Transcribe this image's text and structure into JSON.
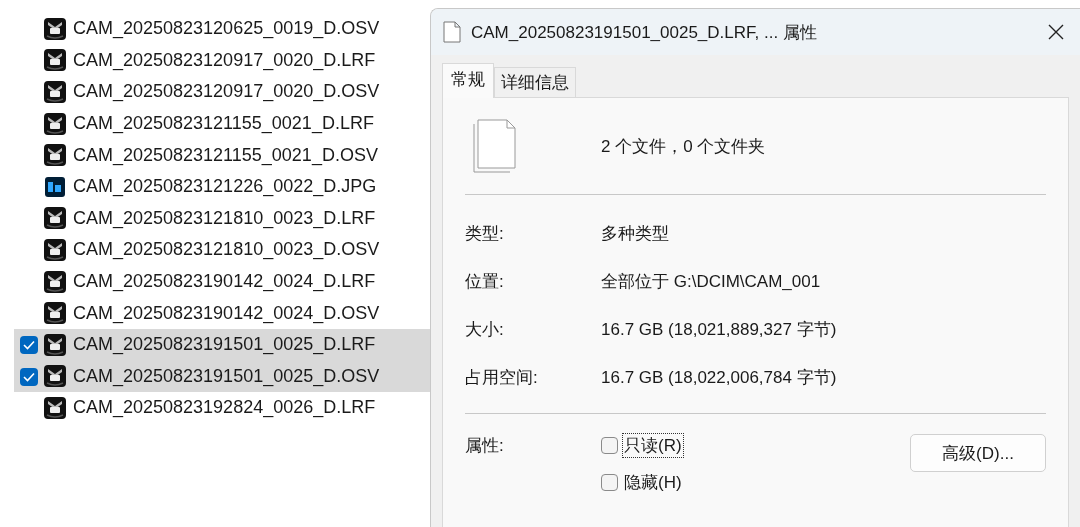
{
  "file_list": [
    {
      "name": "CAM_20250823120625_0019_D.OSV",
      "kind": "video",
      "selected": false
    },
    {
      "name": "CAM_20250823120917_0020_D.LRF",
      "kind": "video",
      "selected": false
    },
    {
      "name": "CAM_20250823120917_0020_D.OSV",
      "kind": "video",
      "selected": false
    },
    {
      "name": "CAM_20250823121155_0021_D.LRF",
      "kind": "video",
      "selected": false
    },
    {
      "name": "CAM_20250823121155_0021_D.OSV",
      "kind": "video",
      "selected": false
    },
    {
      "name": "CAM_20250823121226_0022_D.JPG",
      "kind": "image",
      "selected": false
    },
    {
      "name": "CAM_20250823121810_0023_D.LRF",
      "kind": "video",
      "selected": false
    },
    {
      "name": "CAM_20250823121810_0023_D.OSV",
      "kind": "video",
      "selected": false
    },
    {
      "name": "CAM_20250823190142_0024_D.LRF",
      "kind": "video",
      "selected": false
    },
    {
      "name": "CAM_20250823190142_0024_D.OSV",
      "kind": "video",
      "selected": false
    },
    {
      "name": "CAM_20250823191501_0025_D.LRF",
      "kind": "video",
      "selected": true
    },
    {
      "name": "CAM_20250823191501_0025_D.OSV",
      "kind": "video",
      "selected": true
    },
    {
      "name": "CAM_20250823192824_0026_D.LRF",
      "kind": "video",
      "selected": false
    }
  ],
  "dialog": {
    "title": "CAM_20250823191501_0025_D.LRF, ... 属性",
    "tabs": [
      {
        "label": "常规",
        "selected": true
      },
      {
        "label": "详细信息",
        "selected": false
      }
    ],
    "summary": "2 个文件，0 个文件夹",
    "details": [
      {
        "label": "类型:",
        "value": "多种类型"
      },
      {
        "label": "位置:",
        "value": "全部位于 G:\\DCIM\\CAM_001"
      },
      {
        "label": "大小:",
        "value": "16.7 GB (18,021,889,327 字节)"
      },
      {
        "label": "占用空间:",
        "value": "16.7 GB (18,022,006,784 字节)"
      }
    ],
    "attributes": {
      "label": "属性:",
      "checkboxes": [
        {
          "label": "只读(R)",
          "checked": false,
          "focused": true
        },
        {
          "label": "隐藏(H)",
          "checked": false,
          "focused": false
        }
      ],
      "button": "高级(D)..."
    }
  }
}
